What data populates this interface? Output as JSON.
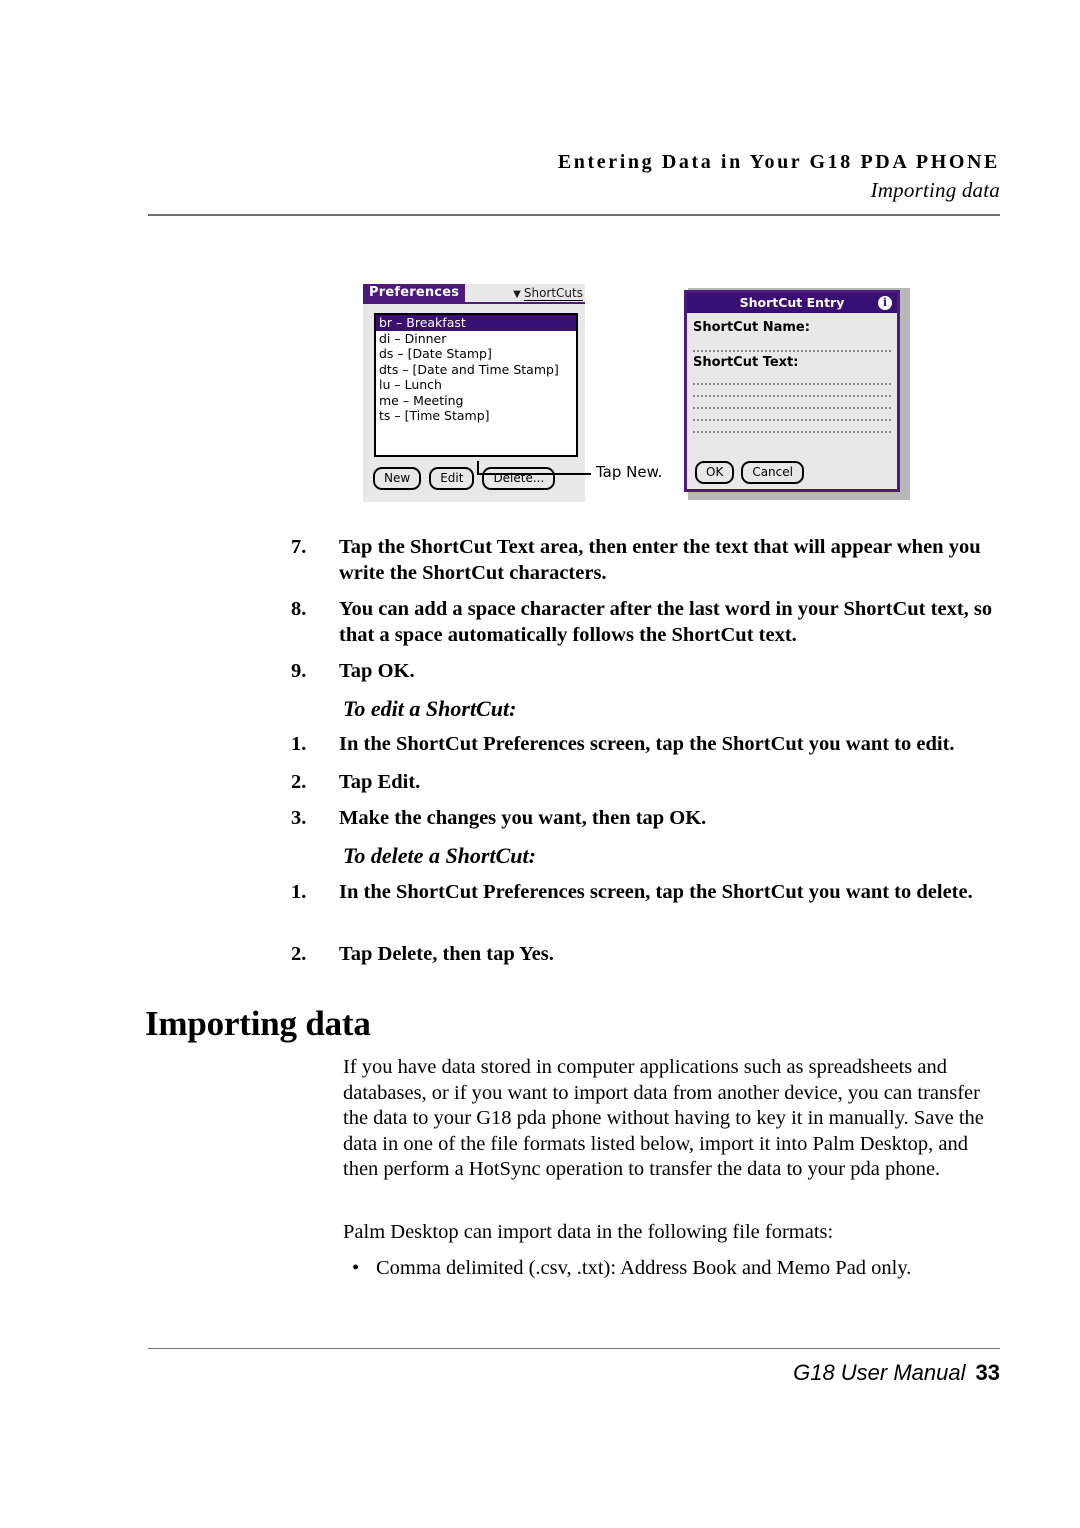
{
  "header": {
    "title": "Entering Data in Your G18 PDA PHONE",
    "subtitle": "Importing data"
  },
  "figure": {
    "preferences_screen": {
      "tab_label": "Preferences",
      "dropdown_caret": "▼",
      "dropdown_label": "ShortCuts",
      "list_items": [
        "br – Breakfast",
        "di – Dinner",
        "ds – [Date Stamp]",
        "dts – [Date and Time Stamp]",
        "lu – Lunch",
        "me – Meeting",
        "ts – [Time Stamp]"
      ],
      "selected_index": 0,
      "buttons": [
        "New",
        "Edit",
        "Delete..."
      ]
    },
    "callout": {
      "text": "Tap New."
    },
    "shortcut_entry_dialog": {
      "title": "ShortCut Entry",
      "info_icon": "i",
      "name_label": "ShortCut Name:",
      "text_label": "ShortCut Text:",
      "name_field_value": "",
      "text_field_value": "",
      "buttons": [
        "OK",
        "Cancel"
      ]
    },
    "colors": {
      "title_purple": "#3a0f74",
      "tab_purple": "#4b1a7a",
      "screen_gray": "#e8e8e8"
    }
  },
  "steps_continued": [
    {
      "number": "7.",
      "text": "Tap the ShortCut Text area, then enter the text that will appear when you write the ShortCut characters."
    },
    {
      "number": "8.",
      "text": "You can add a space character after the last word in your ShortCut text, so that a space automatically follows the ShortCut text."
    },
    {
      "number": "9.",
      "text": "Tap OK."
    }
  ],
  "edit_section": {
    "heading": "To edit a ShortCut:",
    "steps": [
      {
        "number": "1.",
        "text": "In the ShortCut Preferences screen, tap the ShortCut you want to edit."
      },
      {
        "number": "2.",
        "text": "Tap Edit."
      },
      {
        "number": "3.",
        "text": "Make the changes you want, then tap OK."
      }
    ]
  },
  "delete_section": {
    "heading": "To delete a ShortCut:",
    "steps": [
      {
        "number": "1.",
        "text": "In the ShortCut Preferences screen, tap the ShortCut you want to delete."
      },
      {
        "number": "2.",
        "text": "Tap Delete, then tap Yes."
      }
    ]
  },
  "importing": {
    "heading": "Importing data",
    "paragraph": "If you have data stored in computer applications such as spreadsheets and databases, or if you want to import data from another device, you can transfer the data to your G18 pda phone without having to key it in manually. Save the data in one of the file formats listed below, import it into Palm Desktop, and then perform a HotSync operation to transfer the data to your pda phone.",
    "formats_intro": "Palm Desktop can import data in the following file formats:",
    "bullet_marker": "•",
    "formats": [
      "Comma delimited (.csv, .txt): Address Book and Memo Pad only."
    ]
  },
  "footer": {
    "label": "G18 User Manual",
    "page_number": "33"
  }
}
